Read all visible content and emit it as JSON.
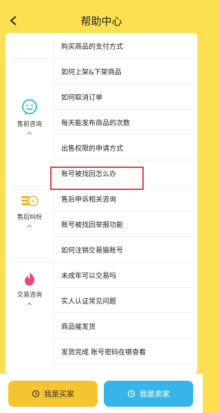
{
  "header": {
    "title": "帮助中心"
  },
  "categories": [
    {
      "label": "售前咨询",
      "icon": "smile-chat-icon"
    },
    {
      "label": "售后纠纷",
      "icon": "coin-stack-icon"
    },
    {
      "label": "交易咨询",
      "icon": "flame-icon"
    }
  ],
  "items": [
    "购买商品的支付方式",
    "如何上架&下架商品",
    "如何取消订单",
    "每天能发布商品的次数",
    "出售权限的申请方式",
    "账号被找回怎么办",
    "售后申诉相关咨询",
    "账号被找回举报功能",
    "如何注销交易猫账号",
    "未成年可以交易吗",
    "实人认证常见问题",
    "商品催发货",
    "发货完成 账号密码在哪查看"
  ],
  "buttons": {
    "buyer": "我是买家",
    "seller": "我是卖家"
  },
  "colors": {
    "header": "#fce052",
    "highlight": "#e23a3a",
    "buyer": "#f4c431",
    "seller": "#36b6e8"
  }
}
